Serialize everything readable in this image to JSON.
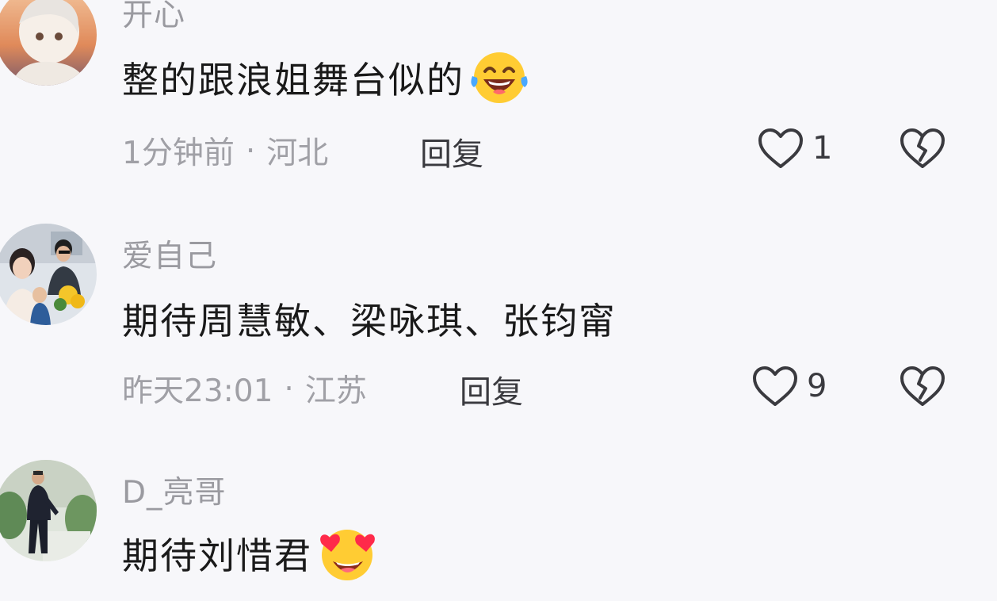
{
  "comments": [
    {
      "username": "开心",
      "text": "整的跟浪姐舞台似的",
      "emoji": "laughing-tears-emoji",
      "time": "1分钟前",
      "separator": "·",
      "location": "河北",
      "reply_label": "回复",
      "likes": "1",
      "avatar": "anime-avatar"
    },
    {
      "username": "爱自己",
      "text": "期待周慧敏、梁咏琪、张钧甯",
      "emoji": "",
      "time": "昨天23:01",
      "separator": "·",
      "location": "江苏",
      "reply_label": "回复",
      "likes": "9",
      "avatar": "family-photo-avatar"
    },
    {
      "username": "D_亮哥",
      "text": "期待刘惜君",
      "emoji": "heart-eyes-emoji",
      "avatar": "suit-man-avatar"
    }
  ],
  "icons": {
    "like": "heart-outline-icon",
    "dislike": "broken-heart-icon"
  },
  "colors": {
    "background": "#f7f7fa",
    "text_primary": "#1a1a1a",
    "text_secondary": "#9a9aa0",
    "action_text": "#3a3a3f"
  }
}
